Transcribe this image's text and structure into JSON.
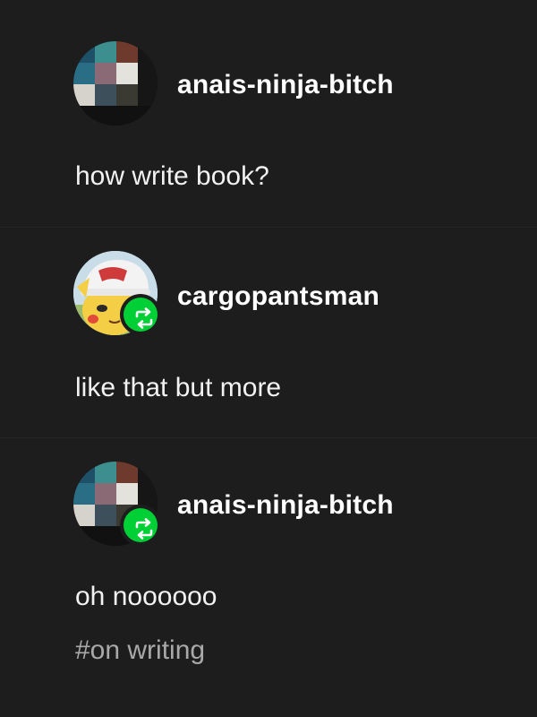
{
  "thread": [
    {
      "username": "anais-ninja-bitch",
      "body": "how write book?",
      "avatar_icon": "pixel-mosaic-avatar",
      "reblogged": false
    },
    {
      "username": "cargopantsman",
      "body": "like that but more",
      "avatar_icon": "pikachu-cap-avatar",
      "reblogged": true
    },
    {
      "username": "anais-ninja-bitch",
      "body": "oh noooooo",
      "avatar_icon": "pixel-mosaic-avatar",
      "reblogged": true
    }
  ],
  "tags": [
    "#on writing"
  ],
  "colors": {
    "background": "#1d1d1d",
    "reblog_badge": "#00cf35",
    "tag_text": "#a9a9a9"
  }
}
